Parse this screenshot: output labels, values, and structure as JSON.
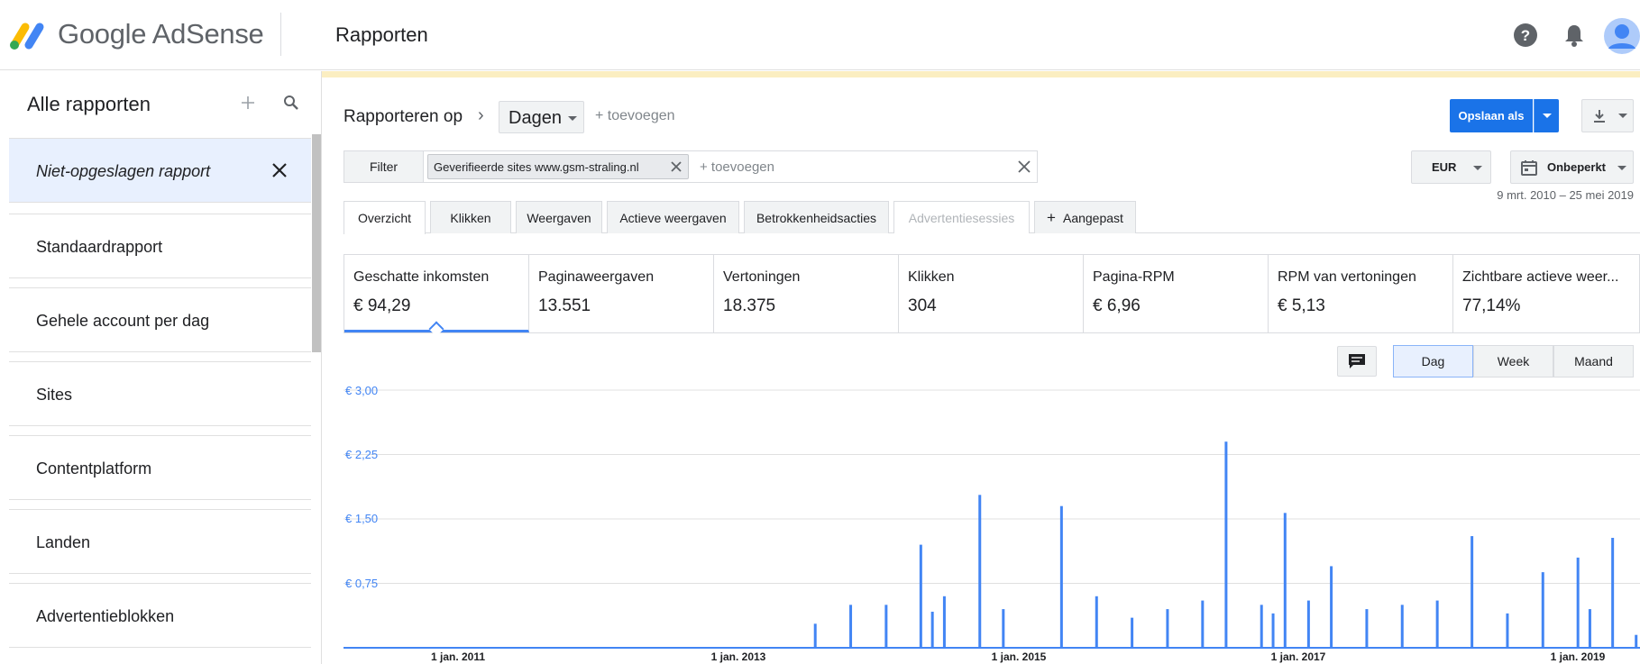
{
  "app": {
    "brand": "Google AdSense",
    "page_title": "Rapporten"
  },
  "sidebar": {
    "title": "Alle rapporten",
    "active_report": "Niet-opgeslagen rapport",
    "items": [
      {
        "label": "Standaardrapport"
      },
      {
        "label": "Gehele account per dag"
      },
      {
        "label": "Sites"
      },
      {
        "label": "Contentplatform"
      },
      {
        "label": "Landen"
      },
      {
        "label": "Advertentieblokken"
      }
    ]
  },
  "toolbar": {
    "report_on_label": "Rapporteren op",
    "dimension": "Dagen",
    "add_dimension": "+ toevoegen",
    "save_label": "Opslaan als",
    "filter_label": "Filter",
    "filter_chip": "Geverifieerde sites www.gsm-straling.nl",
    "filter_add": "+ toevoegen",
    "currency": "EUR",
    "date_preset": "Onbeperkt",
    "date_range": "9 mrt. 2010 – 25 mei 2019"
  },
  "tabs": [
    {
      "label": "Overzicht"
    },
    {
      "label": "Klikken"
    },
    {
      "label": "Weergaven"
    },
    {
      "label": "Actieve weergaven"
    },
    {
      "label": "Betrokkenheidsacties"
    },
    {
      "label": "Advertentiesessies"
    },
    {
      "label": "Aangepast"
    }
  ],
  "metrics": [
    {
      "name": "Geschatte inkomsten",
      "value": "€ 94,29"
    },
    {
      "name": "Paginaweergaven",
      "value": "13.551"
    },
    {
      "name": "Vertoningen",
      "value": "18.375"
    },
    {
      "name": "Klikken",
      "value": "304"
    },
    {
      "name": "Pagina-RPM",
      "value": "€ 6,96"
    },
    {
      "name": "RPM van vertoningen",
      "value": "€ 5,13"
    },
    {
      "name": "Zichtbare actieve weer...",
      "value": "77,14%"
    }
  ],
  "granularity": [
    {
      "label": "Dag"
    },
    {
      "label": "Week"
    },
    {
      "label": "Maand"
    }
  ],
  "colors": {
    "accent": "#1a73e8",
    "series": "#4285f4"
  },
  "chart_data": {
    "type": "bar",
    "ylim": [
      0,
      3
    ],
    "y_ticks": [
      "€ 3,00",
      "€ 2,25",
      "€ 1,50",
      "€ 0,75"
    ],
    "x_ticks": [
      "1 jan. 2011",
      "1 jan. 2013",
      "1 jan. 2015",
      "1 jan. 2017",
      "1 jan. 2019"
    ],
    "x": [
      "2013-07",
      "2013-10",
      "2014-01",
      "2014-04",
      "2014-05",
      "2014-06",
      "2014-09",
      "2014-11",
      "2015-04",
      "2015-07",
      "2015-10",
      "2016-01",
      "2016-04",
      "2016-06",
      "2016-09",
      "2016-10",
      "2016-11",
      "2017-01",
      "2017-03",
      "2017-06",
      "2017-09",
      "2017-12",
      "2018-03",
      "2018-06",
      "2018-09",
      "2018-12",
      "2019-01",
      "2019-03",
      "2019-05"
    ],
    "values": [
      0.28,
      0.5,
      0.5,
      1.2,
      0.42,
      0.6,
      1.78,
      0.45,
      1.65,
      0.6,
      0.35,
      0.45,
      0.55,
      2.4,
      0.5,
      0.4,
      1.57,
      0.55,
      0.95,
      0.45,
      0.5,
      0.55,
      1.3,
      0.4,
      0.88,
      1.05,
      0.45,
      1.28,
      0.15
    ]
  }
}
